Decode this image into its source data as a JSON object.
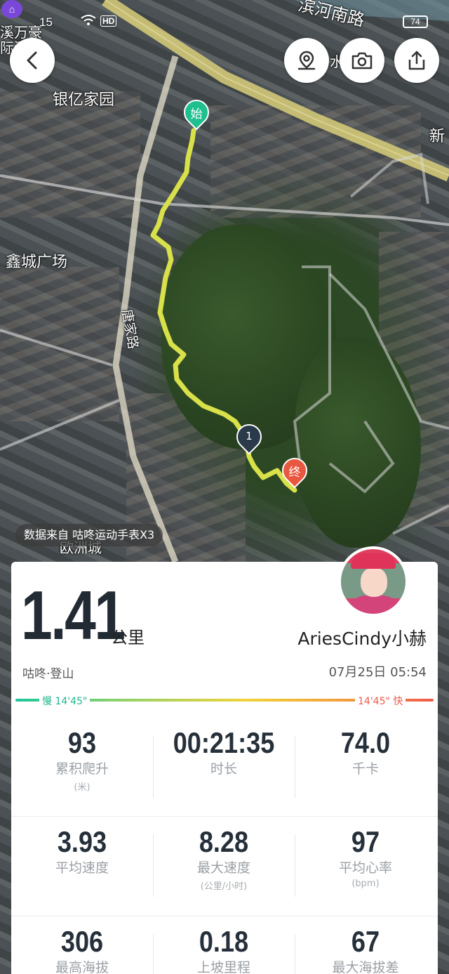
{
  "status_bar": {
    "time": "15",
    "hd_badge": "HD",
    "battery": "74"
  },
  "map": {
    "labels": {
      "road_binhe": "滨河南路",
      "compound_yinyi": "银亿家园",
      "plaza_xincheng": "鑫城广场",
      "road_tangjia": "唐家路",
      "mall_ouzhou": "欧洲城",
      "top_left_1": "溪万豪",
      "top_left_2": "际酒",
      "right_edge": "新",
      "water_label": "水"
    },
    "start_marker": "始",
    "end_marker": "终",
    "km_marker": "1",
    "route_color": "#d8e04a"
  },
  "data_source": "数据来自 咕咚运动手表X3",
  "summary": {
    "distance": "1.41",
    "distance_unit": "公里",
    "username": "AriesCindy小赫",
    "sport_type": "咕咚·登山",
    "datetime": "07月25日 05:54",
    "pace_slow": "慢 14'45\"",
    "pace_fast": "14'45\" 快"
  },
  "stats": [
    {
      "value": "93",
      "label": "累积爬升",
      "unit": "(米)"
    },
    {
      "value": "00:21:35",
      "label": "时长",
      "unit": ""
    },
    {
      "value": "74.0",
      "label": "千卡",
      "unit": ""
    },
    {
      "value": "3.93",
      "label": "平均速度",
      "unit": ""
    },
    {
      "value": "8.28",
      "label": "最大速度",
      "unit": "(公里/小时)"
    },
    {
      "value": "97",
      "label": "平均心率",
      "unit": "(bpm)"
    },
    {
      "value": "306",
      "label": "最高海拔",
      "unit": ""
    },
    {
      "value": "0.18",
      "label": "上坡里程",
      "unit": ""
    },
    {
      "value": "67",
      "label": "最大海拔差",
      "unit": ""
    }
  ],
  "colors": {
    "start": "#1fbf8f",
    "end": "#e8573f",
    "km": "#2a3a4a"
  }
}
